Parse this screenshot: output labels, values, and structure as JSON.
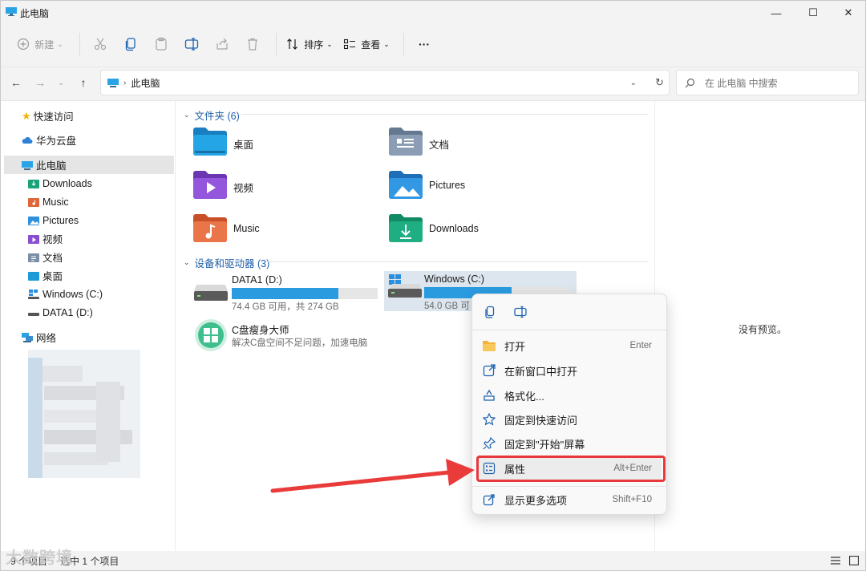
{
  "window": {
    "title": "此电脑",
    "minimize_label": "—",
    "maximize_label": "☐",
    "close_label": "✕"
  },
  "toolbar": {
    "new_label": "新建",
    "sort_label": "排序",
    "view_label": "查看",
    "more_label": "···"
  },
  "address": {
    "path": "此电脑",
    "search_placeholder": "在 此电脑 中搜索"
  },
  "sidebar": {
    "items": [
      {
        "label": "快速访问",
        "icon": "star-icon"
      },
      {
        "label": "华为云盘",
        "icon": "cloud-icon"
      },
      {
        "label": "此电脑",
        "icon": "computer-icon"
      },
      {
        "label": "Downloads",
        "icon": "downloads-folder-icon"
      },
      {
        "label": "Music",
        "icon": "music-folder-icon"
      },
      {
        "label": "Pictures",
        "icon": "pictures-folder-icon"
      },
      {
        "label": "视频",
        "icon": "videos-folder-icon"
      },
      {
        "label": "文档",
        "icon": "documents-folder-icon"
      },
      {
        "label": "桌面",
        "icon": "desktop-folder-icon"
      },
      {
        "label": "Windows (C:)",
        "icon": "windows-drive-icon"
      },
      {
        "label": "DATA1 (D:)",
        "icon": "drive-icon"
      },
      {
        "label": "网络",
        "icon": "network-icon"
      }
    ]
  },
  "main": {
    "folders_header": "文件夹 (6)",
    "folders": [
      {
        "label": "桌面",
        "icon": "desktop-folder-icon",
        "color": "#1e9bd7"
      },
      {
        "label": "文档",
        "icon": "documents-folder-icon",
        "color": "#7b8ea6"
      },
      {
        "label": "视频",
        "icon": "videos-folder-icon",
        "color": "#8a4fd0"
      },
      {
        "label": "Pictures",
        "icon": "pictures-folder-icon",
        "color": "#2f8fdc"
      },
      {
        "label": "Music",
        "icon": "music-folder-icon",
        "color": "#e0663a"
      },
      {
        "label": "Downloads",
        "icon": "downloads-folder-icon",
        "color": "#1aa37a"
      }
    ],
    "devices_header": "设备和驱动器 (3)",
    "drives": [
      {
        "name": "DATA1 (D:)",
        "info": "74.4 GB 可用，共 274 GB",
        "used_fraction": 0.73
      },
      {
        "name": "Windows (C:)",
        "info": "54.0 GB 可",
        "used_fraction": 0.6
      }
    ],
    "cleaner": {
      "name": "C盘瘦身大师",
      "desc": "解决C盘空间不足问题，加速电脑"
    }
  },
  "preview": {
    "text": "没有预览。"
  },
  "status": {
    "items": "9 个项目",
    "selected": "选中 1 个项目"
  },
  "context_menu": {
    "items": [
      {
        "label": "打开",
        "shortcut": "Enter",
        "icon": "folder-open-icon"
      },
      {
        "label": "在新窗口中打开",
        "shortcut": "",
        "icon": "new-window-icon"
      },
      {
        "label": "格式化...",
        "shortcut": "",
        "icon": "format-icon"
      },
      {
        "label": "固定到快速访问",
        "shortcut": "",
        "icon": "pin-star-icon"
      },
      {
        "label": "固定到\"开始\"屏幕",
        "shortcut": "",
        "icon": "pin-icon"
      },
      {
        "label": "属性",
        "shortcut": "Alt+Enter",
        "icon": "properties-icon"
      },
      {
        "label": "显示更多选项",
        "shortcut": "Shift+F10",
        "icon": "more-options-icon"
      }
    ]
  },
  "colors": {
    "accent": "#2b9be0",
    "highlight_red": "#e8383b"
  },
  "watermark": "大数跨境"
}
